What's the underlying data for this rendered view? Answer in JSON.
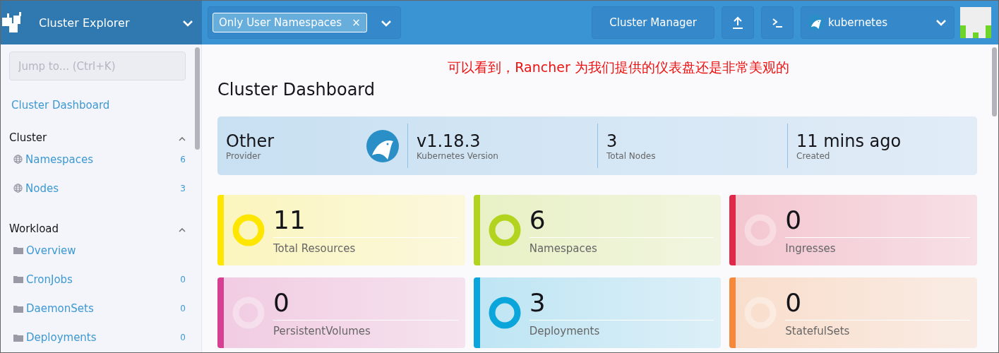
{
  "header": {
    "product": "Cluster Explorer",
    "namespace_filter": {
      "chip": "Only User Namespaces",
      "remove": "×"
    },
    "cluster_manager": "Cluster Manager",
    "cluster": "kubernetes"
  },
  "sidebar": {
    "search": {
      "placeholder": "Jump to... (Ctrl+K)"
    },
    "dashboard_link": "Cluster Dashboard",
    "groups": [
      {
        "title": "Cluster",
        "expanded": true,
        "items": [
          {
            "label": "Namespaces",
            "count": "6",
            "kind": "globe"
          },
          {
            "label": "Nodes",
            "count": "3",
            "kind": "globe"
          }
        ]
      },
      {
        "title": "Workload",
        "expanded": true,
        "items": [
          {
            "label": "Overview",
            "kind": "folder"
          },
          {
            "label": "CronJobs",
            "count": "0",
            "kind": "folder"
          },
          {
            "label": "DaemonSets",
            "count": "0",
            "kind": "folder"
          },
          {
            "label": "Deployments",
            "count": "0",
            "kind": "folder"
          }
        ]
      }
    ]
  },
  "annotation": "可以看到，Rancher 为我们提供的仪表盘还是非常美观的",
  "page_title": "Cluster Dashboard",
  "summary": [
    {
      "value": "Other",
      "label": "Provider"
    },
    {
      "value": "v1.18.3",
      "label": "Kubernetes Version"
    },
    {
      "value": "3",
      "label": "Total Nodes"
    },
    {
      "value": "11 mins ago",
      "label": "Created"
    }
  ],
  "tiles": [
    {
      "count": "11",
      "label": "Total Resources",
      "color": "#ffe600",
      "empty": false
    },
    {
      "count": "6",
      "label": "Namespaces",
      "color": "#b3d41e",
      "empty": false
    },
    {
      "count": "0",
      "label": "Ingresses",
      "color": "#e0294a",
      "empty": true
    },
    {
      "count": "0",
      "label": "PersistentVolumes",
      "color": "#d63f92",
      "empty": true
    },
    {
      "count": "3",
      "label": "Deployments",
      "color": "#0aa5da",
      "empty": false
    },
    {
      "count": "0",
      "label": "StatefulSets",
      "color": "#f5883a",
      "empty": true
    }
  ]
}
